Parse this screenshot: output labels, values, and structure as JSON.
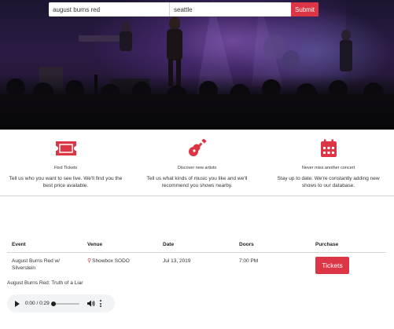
{
  "search": {
    "artist_value": "august burns red",
    "city_value": "seattle",
    "submit_label": "Submit"
  },
  "features": [
    {
      "icon": "ticket-icon",
      "title": "Find Tickets",
      "desc": "Tell us who you want to see live. We'll find you the best price available."
    },
    {
      "icon": "guitar-icon",
      "title": "Discover new artists",
      "desc": "Tell us what kinds of music you like and we'll recommend you shows nearby."
    },
    {
      "icon": "calendar-icon",
      "title": "Never miss another concert",
      "desc": "Stay up to date. We're constantly adding new shows to our database."
    }
  ],
  "table": {
    "headers": [
      "Event",
      "Venue",
      "Date",
      "Doors",
      "Purchase"
    ],
    "rows": [
      {
        "event": "August Burns Red w/ Silverstein",
        "venue": "Showbox SODO",
        "date": "Jul 13, 2019",
        "doors": "7:00 PM",
        "purchase_label": "Tickets"
      }
    ]
  },
  "player": {
    "track_title": "August Burns Red: Truth of a Liar",
    "time": "0:00 / 0:29",
    "progress": 0
  },
  "colors": {
    "accent": "#dc3545"
  }
}
